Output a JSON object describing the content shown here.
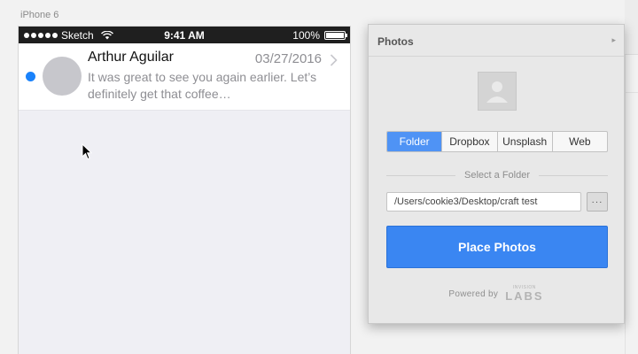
{
  "artboard": {
    "label": "iPhone 6"
  },
  "status_bar": {
    "carrier": "Sketch",
    "time": "9:41 AM",
    "battery": "100%",
    "battery_level": 1.0
  },
  "message": {
    "sender": "Arthur Aguilar",
    "date": "03/27/2016",
    "preview": "It was great to see you again earlier. Let’s definitely get that coffee…",
    "unread": true
  },
  "panel": {
    "title": "Photos",
    "source_tabs": [
      "Folder",
      "Dropbox",
      "Unsplash",
      "Web"
    ],
    "active_tab": "Folder",
    "section_label": "Select a Folder",
    "folder_path": "/Users/cookie3/Desktop/craft test",
    "browse_label": "···",
    "place_button": "Place Photos",
    "powered_by": "Powered by",
    "logo_small": "INVISION",
    "logo_big": "LABS"
  },
  "colors": {
    "accent": "#3a86f2",
    "unread_dot": "#1a82fb",
    "status_bar": "#1f1f1f"
  },
  "icons": [
    "wifi-icon",
    "battery-icon",
    "chevron-right-icon",
    "image-placeholder-icon",
    "mouse-cursor-icon",
    "panel-expand-arrow-icon"
  ]
}
